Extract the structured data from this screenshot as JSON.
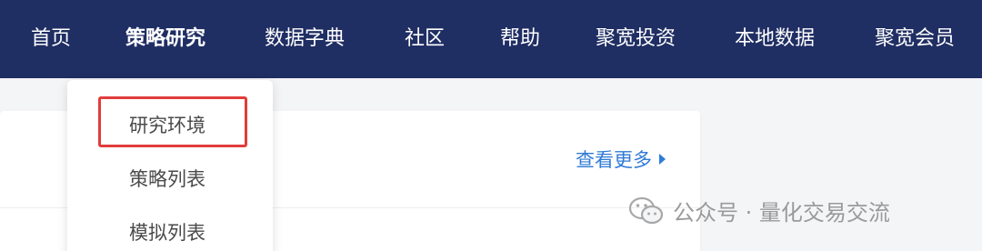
{
  "nav": {
    "items": [
      {
        "label": "首页"
      },
      {
        "label": "策略研究",
        "active": true
      },
      {
        "label": "数据字典"
      },
      {
        "label": "社区"
      },
      {
        "label": "帮助"
      },
      {
        "label": "聚宽投资"
      },
      {
        "label": "本地数据"
      },
      {
        "label": "聚宽会员"
      }
    ]
  },
  "dropdown": {
    "items": [
      {
        "label": "研究环境",
        "highlighted": true
      },
      {
        "label": "策略列表"
      },
      {
        "label": "模拟列表"
      }
    ]
  },
  "content": {
    "see_more_label": "查看更多"
  },
  "watermark": {
    "text": "公众号 · 量化交易交流",
    "icon": "wechat-icon"
  },
  "colors": {
    "navbar_bg": "#1f2e63",
    "link": "#2f7bd6",
    "highlight_border": "#e23c3c"
  }
}
